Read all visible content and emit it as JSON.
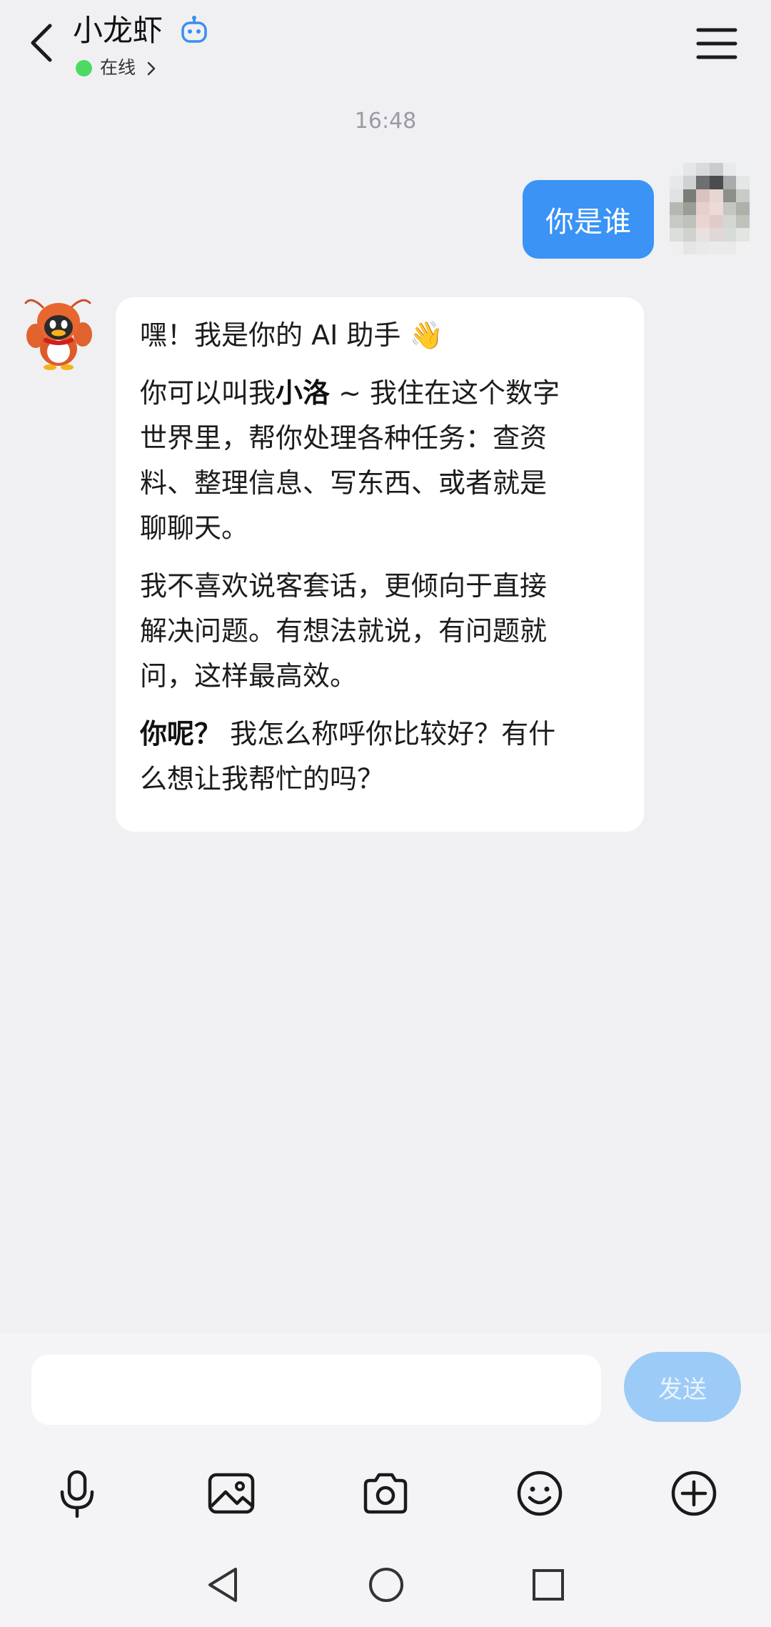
{
  "header": {
    "title": "小龙虾",
    "status": "在线",
    "status_color": "#4cd964",
    "icons": {
      "back": "chevron-left-icon",
      "bot": "robot-icon",
      "menu": "menu-icon",
      "status_arrow": "chevron-right-icon"
    }
  },
  "chat": {
    "timestamp": "16:48",
    "user_message": "你是谁",
    "bot_message": {
      "p1": "嘿！我是你的 AI 助手 👋",
      "p2_pre": "你可以叫我",
      "p2_name": "小洛",
      "p2_line1_rest": "~ 我住在这个数字",
      "p2_line2": "世界里，帮你处理各种任务：查资",
      "p2_line3": "料、整理信息、写东西、或者就是",
      "p2_line4": "聊聊天。",
      "p3_line1": "我不喜欢说客套话，更倾向于直接",
      "p3_line2": "解决问题。有想法就说，有问题就",
      "p3_line3": "问，这样最高效。",
      "p4_bold": "你呢？",
      "p4_line1_rest": "我怎么称呼你比较好？有什",
      "p4_line2": "么想让我帮忙的吗？"
    },
    "user_bubble_color": "#3a93f5"
  },
  "composer": {
    "input_value": "",
    "send_label": "发送",
    "send_color": "#9ccbf7"
  },
  "toolbar": {
    "items": [
      "microphone-icon",
      "image-icon",
      "camera-icon",
      "emoji-icon",
      "plus-icon"
    ]
  },
  "navbar": {
    "items": [
      "nav-back-icon",
      "nav-home-icon",
      "nav-recent-icon"
    ]
  }
}
